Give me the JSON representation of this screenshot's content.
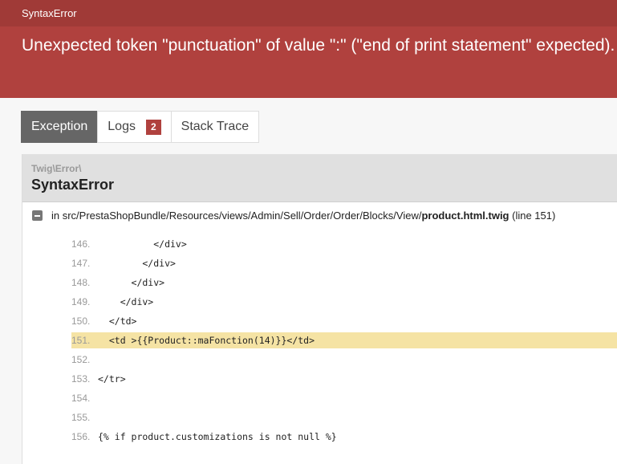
{
  "header": {
    "exception_class": "SyntaxError",
    "message": "Unexpected token \"punctuation\" of value \":\" (\"end of print statement\" expected)."
  },
  "tabs": [
    {
      "label": "Exception",
      "active": true
    },
    {
      "label": "Logs",
      "badge": "2",
      "active": false
    },
    {
      "label": "Stack Trace",
      "active": false
    }
  ],
  "exception": {
    "namespace": "Twig\\Error\\",
    "class": "SyntaxError",
    "trace_prefix": "in src/PrestaShopBundle/Resources/views/Admin/Sell/Order/Order/Blocks/View/",
    "trace_file": "product.html.twig",
    "trace_line": "(line 151)"
  },
  "code": [
    {
      "num": "146.",
      "text": "          </div>"
    },
    {
      "num": "147.",
      "text": "        </div>"
    },
    {
      "num": "148.",
      "text": "      </div>"
    },
    {
      "num": "149.",
      "text": "    </div>"
    },
    {
      "num": "150.",
      "text": "  </td>"
    },
    {
      "num": "151.",
      "text": "  <td >{{Product::maFonction(14)}}</td>",
      "selected": true
    },
    {
      "num": "152.",
      "text": ""
    },
    {
      "num": "153.",
      "text": "</tr>"
    },
    {
      "num": "154.",
      "text": ""
    },
    {
      "num": "155.",
      "text": ""
    },
    {
      "num": "156.",
      "text": "{% if product.customizations is not null %}"
    }
  ],
  "colors": {
    "header_bg": "#b0413e",
    "header_bar_bg": "#a03a37",
    "highlight": "#f5e3a4",
    "active_tab": "#666666"
  }
}
